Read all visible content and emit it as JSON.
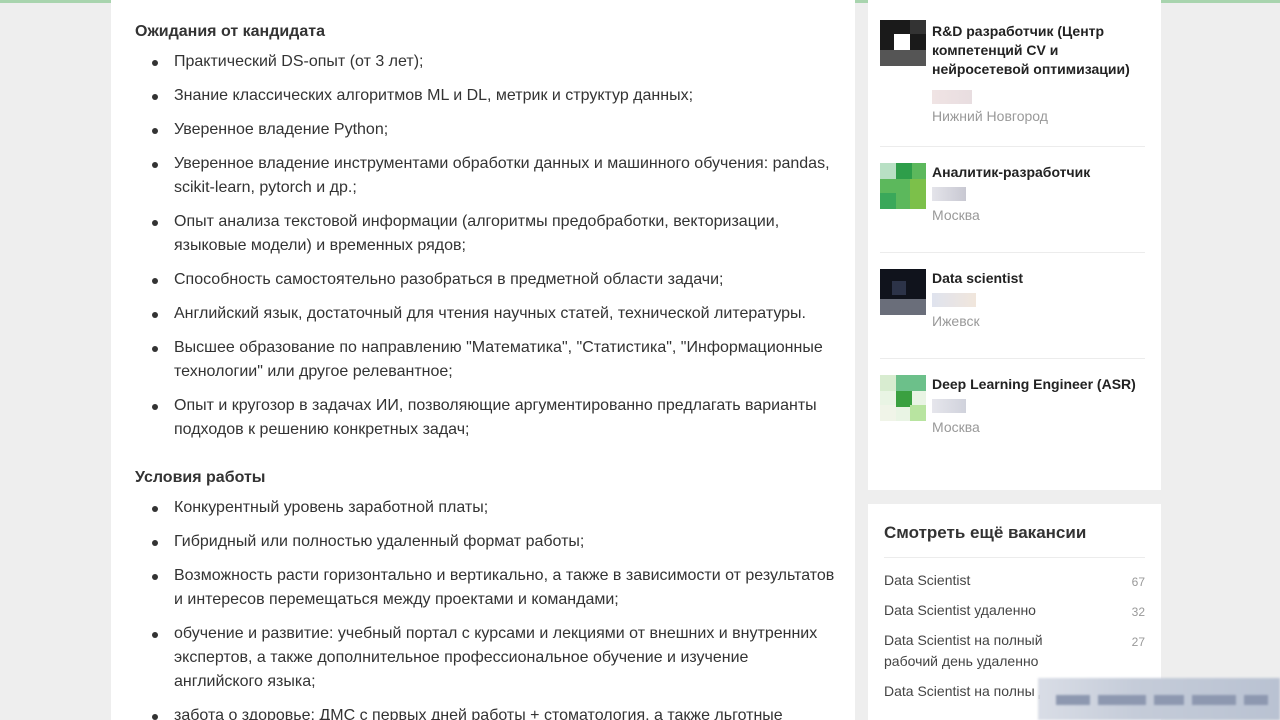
{
  "requirements": {
    "heading": "Ожидания от кандидата",
    "items": [
      "Практический DS-опыт (от 3 лет);",
      "Знание классических алгоритмов ML и DL, метрик и структур данных;",
      "Уверенное владение Python;",
      "Уверенное владение инструментами обработки данных и машинного обучения: pandas, scikit-learn, pytorch и др.;",
      "Опыт анализа текстовой информации (алгоритмы предобработки, векторизации, языковые модели) и временных рядов;",
      "Способность самостоятельно разобраться в предметной области задачи;",
      "Английский язык, достаточный для чтения научных статей, технической литературы.",
      "Высшее образование по направлению \"Математика\", \"Статистика\", \"Информационные технологии\" или другое релевантное;",
      "Опыт и кругозор в задачах ИИ, позволяющие аргументированно предлагать варианты подходов к решению конкретных задач;"
    ]
  },
  "conditions": {
    "heading": "Условия работы",
    "items": [
      "Конкурентный уровень заработной платы;",
      "Гибридный или полностью удаленный формат работы;",
      "Возможность расти горизонтально и вертикально, а также в зависимости от результатов и интересов перемещаться между проектами и командами;",
      "обучение и развитие: учебный портал с курсами и лекциями от внешних и внутренних экспертов, а также дополнительное профессиональное обучение и изучение английского языка;",
      "забота о здоровье: ДМС с первых дней работы + стоматология, а также льготные"
    ]
  },
  "similar_jobs": [
    {
      "title": "R&D разработчик (Центр компетенций CV и нейросетевой оптимизации)",
      "city": "Нижний Новгород",
      "logo": "dark-logo"
    },
    {
      "title": "Аналитик-разработчик",
      "city": "Москва",
      "logo": "green-logo"
    },
    {
      "title": "Data scientist",
      "city": "Ижевск",
      "logo": "dark-blue-logo"
    },
    {
      "title": "Deep Learning Engineer (ASR)",
      "city": "Москва",
      "logo": "green-logo"
    }
  ],
  "more_vacancies": {
    "heading": "Смотреть ещё вакансии",
    "items": [
      {
        "label": "Data Scientist",
        "count": "67"
      },
      {
        "label": "Data Scientist удаленно",
        "count": "32"
      },
      {
        "label": "Data Scientist на полный рабочий день удаленно",
        "count": "27"
      },
      {
        "label": "Data Scientist на полны день",
        "count": ""
      }
    ]
  },
  "colors": {
    "page_bg": "#eeeeee",
    "text": "#333333",
    "muted": "#999999",
    "top_accent": "#a8d4ae"
  }
}
